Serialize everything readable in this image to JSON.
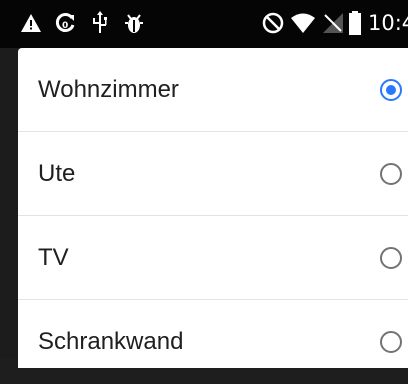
{
  "status_bar": {
    "time": "10:4",
    "left_icons": [
      "warning-icon",
      "refresh-icon",
      "usb-icon",
      "debug-icon"
    ],
    "right_icons": [
      "do-not-disturb-icon",
      "wifi-icon",
      "signal-icon",
      "battery-icon"
    ]
  },
  "dialog": {
    "options": [
      {
        "label": "Wohnzimmer",
        "selected": true
      },
      {
        "label": "Ute",
        "selected": false
      },
      {
        "label": "TV",
        "selected": false
      },
      {
        "label": "Schrankwand",
        "selected": false
      }
    ]
  },
  "colors": {
    "accent": "#2979ff",
    "radio_unselected": "#737373",
    "status_bar": "#050505"
  }
}
